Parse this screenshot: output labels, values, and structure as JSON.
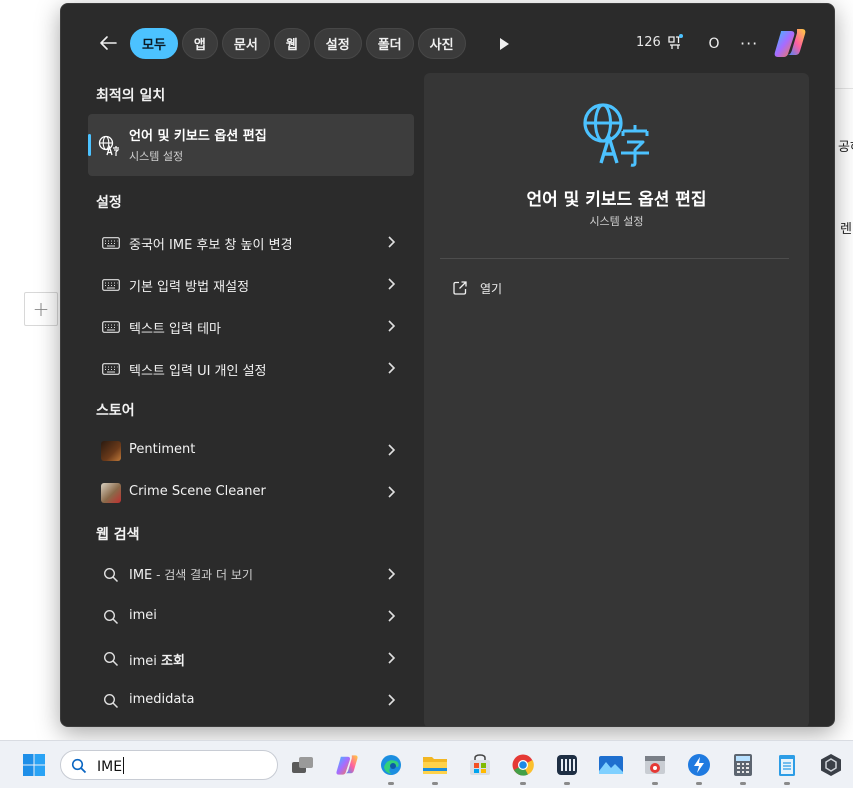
{
  "background": {
    "line1": "공하",
    "line2": "렌이"
  },
  "topbar": {
    "chips": [
      {
        "label": "모두",
        "active": true
      },
      {
        "label": "앱",
        "active": false
      },
      {
        "label": "문서",
        "active": false
      },
      {
        "label": "웹",
        "active": false
      },
      {
        "label": "설정",
        "active": false
      },
      {
        "label": "폴더",
        "active": false
      },
      {
        "label": "사진",
        "active": false
      }
    ],
    "points": "126",
    "avatar_initial": "O",
    "more_label": "···"
  },
  "results": {
    "best_match_title": "최적의 일치",
    "best_match": {
      "title": "언어 및 키보드 옵션 편집",
      "subtitle": "시스템 설정",
      "icon": "language-icon"
    },
    "settings_title": "설정",
    "settings": [
      {
        "label": "중국어 IME 후보 창 높이 변경",
        "icon": "keyboard-icon"
      },
      {
        "label": "기본 입력 방법 재설정",
        "icon": "keyboard-icon"
      },
      {
        "label": "텍스트 입력 테마",
        "icon": "keyboard-icon"
      },
      {
        "label": "텍스트 입력 UI 개인 설정",
        "icon": "keyboard-icon"
      }
    ],
    "store_title": "스토어",
    "store": [
      {
        "label": "Pentiment",
        "icon": "pentiment-app-icon"
      },
      {
        "label": "Crime Scene Cleaner",
        "icon": "crime-scene-cleaner-app-icon"
      }
    ],
    "web_title": "웹 검색",
    "web": [
      {
        "label": "IME",
        "suffix": " - 검색 결과 더 보기"
      },
      {
        "label": "imei",
        "suffix": ""
      },
      {
        "label": "imei ",
        "suffix": "조회"
      },
      {
        "label": "imedidata",
        "suffix": ""
      }
    ]
  },
  "detail": {
    "title": "언어 및 키보드 옵션 편집",
    "subtitle": "시스템 설정",
    "open_label": "열기",
    "accent": "#4cc2ff"
  },
  "taskbar": {
    "search_value": "IME",
    "apps": [
      "task-view-icon",
      "copilot-icon",
      "edge-icon",
      "file-explorer-icon",
      "store-icon",
      "chrome-icon",
      "app-icon",
      "photos-icon",
      "browser-icon",
      "app-icon",
      "calculator-icon",
      "notepad-icon",
      "app-icon"
    ]
  }
}
